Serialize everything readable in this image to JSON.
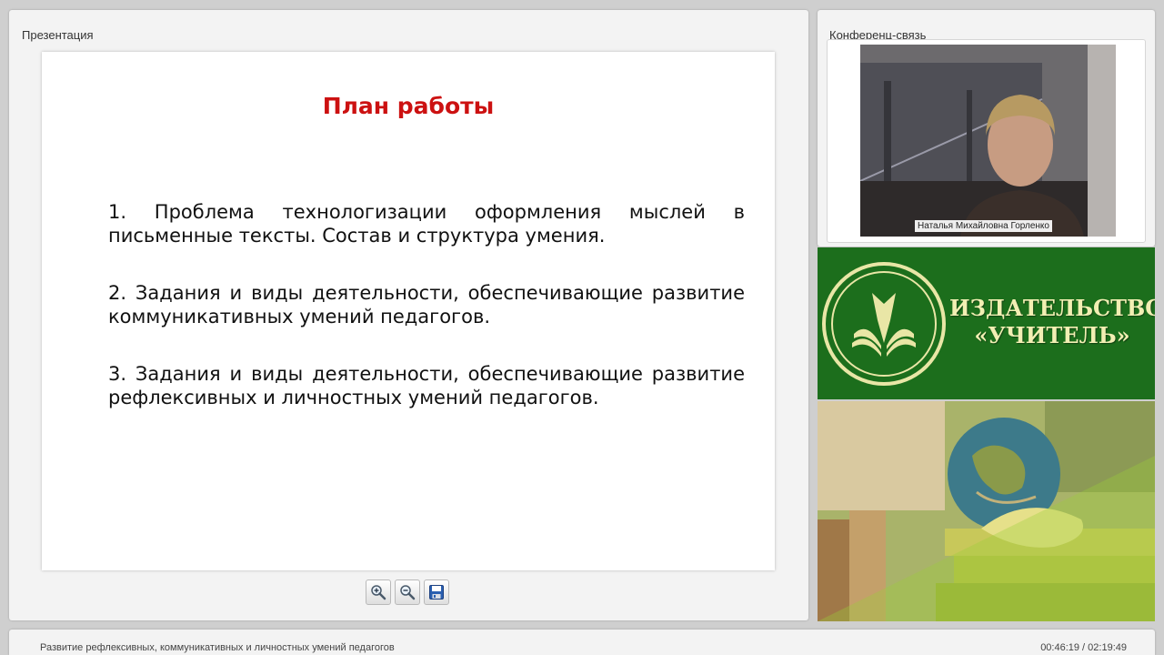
{
  "presentation_panel": {
    "title": "Презентация",
    "slide": {
      "title": "План работы",
      "items": [
        "1. Проблема технологизации оформления мыслей в письменные тексты. Состав и структура умения.",
        "2. Задания и виды деятельности, обеспечивающие развитие коммуникативных умений педагогов.",
        "3. Задания и виды деятельности, обеспечивающие развитие рефлексивных и личностных умений педагогов."
      ]
    },
    "toolbar": {
      "zoom_in": "zoom-in-icon",
      "zoom_out": "zoom-out-icon",
      "save": "save-icon"
    }
  },
  "conference_panel": {
    "title": "Конференц-связь",
    "participant_name": "Наталья Михайловна Горленко"
  },
  "banner": {
    "line1": "ИЗДАТЕЛЬСТВО",
    "line2": "«УЧИТЕЛЬ»"
  },
  "status": {
    "webinar_title": "Развитие рефлексивных, коммуникативных и личностных умений педагогов",
    "time": "00:46:19 / 02:19:49"
  },
  "colors": {
    "slide_title": "#cc1111",
    "banner_bg": "#1c6e1c",
    "banner_text": "#f2efb3"
  }
}
